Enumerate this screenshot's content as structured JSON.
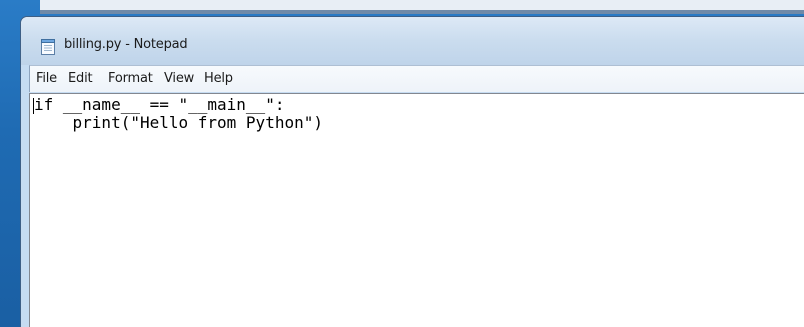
{
  "window": {
    "title": "billing.py - Notepad",
    "icon": "notepad-icon"
  },
  "menubar": {
    "items": [
      "File",
      "Edit",
      "Format",
      "View",
      "Help"
    ]
  },
  "editor": {
    "lines": [
      "if __name__ == \"__main__\":",
      "    print(\"Hello from Python\")"
    ]
  },
  "colors": {
    "desktop": "#1f6bb3",
    "titlebar": "#cadcee",
    "editor_bg": "#ffffff"
  }
}
